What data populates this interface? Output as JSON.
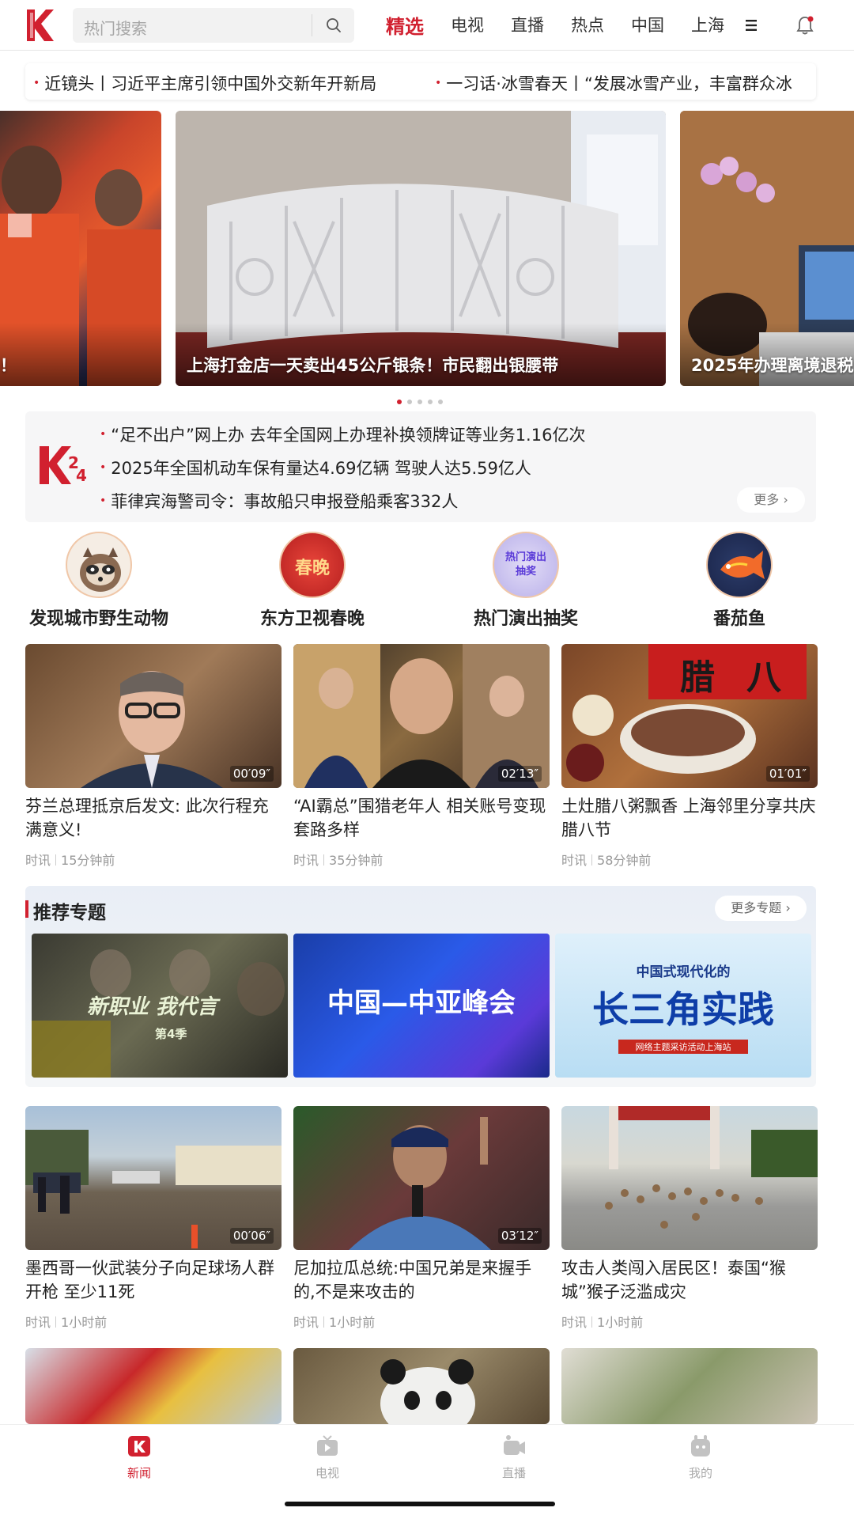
{
  "header": {
    "search_placeholder": "热门搜索",
    "tabs": [
      {
        "label": "精选",
        "active": true
      },
      {
        "label": "电视"
      },
      {
        "label": "直播"
      },
      {
        "label": "热点"
      },
      {
        "label": "中国"
      },
      {
        "label": "上海"
      }
    ]
  },
  "ticker": [
    "近镜头丨习近平主席引领中国外交新年开新局",
    "一习话·冰雪春天丨“发展冰雪产业，丰富群众冰"
  ],
  "carousel": {
    "slides": [
      {
        "caption": "！"
      },
      {
        "caption": "上海打金店一天卖出45公斤银条！市民翻出银腰带"
      },
      {
        "caption": "2025年办理离境退税"
      }
    ],
    "dot_count": 5,
    "active_index": 0
  },
  "newsbox": {
    "items": [
      "“足不出户”网上办 去年全国网上办理补换领牌证等业务1.16亿次",
      "2025年全国机动车保有量达4.69亿辆 驾驶人达5.59亿人",
      "菲律宾海警司令：事故船只申报登船乘客332人"
    ],
    "more_label": "更多 ›"
  },
  "topics": [
    {
      "label": "发现城市野生动物"
    },
    {
      "label": "东方卫视春晚",
      "badge": "春晚"
    },
    {
      "label": "热门演出抽奖",
      "badge": "热门演出抽奖"
    },
    {
      "label": "番茄鱼"
    }
  ],
  "videos_row1": [
    {
      "title": "芬兰总理抵京后发文: 此次行程充满意义!",
      "duration": "00′09″",
      "source": "时讯",
      "time": "15分钟前"
    },
    {
      "title": "“AI霸总”围猎老年人 相关账号变现套路多样",
      "duration": "02′13″",
      "source": "时讯",
      "time": "35分钟前"
    },
    {
      "title": "土灶腊八粥飘香 上海邻里分享共庆腊八节",
      "duration": "01′01″",
      "source": "时讯",
      "time": "58分钟前",
      "badge": "腊八"
    }
  ],
  "recommend": {
    "title": "推荐专题",
    "more_label": "更多专题 ›",
    "banners": [
      {
        "text": "新职业 我代言",
        "sub": "第4季"
      },
      {
        "text": "中国—中亚峰会"
      },
      {
        "text": "长三角实践",
        "top": "中国式现代化的",
        "sub": "网络主题采访活动上海站"
      }
    ]
  },
  "videos_row2": [
    {
      "title": "墨西哥一伙武装分子向足球场人群开枪 至少11死",
      "duration": "00′06″",
      "source": "时讯",
      "time": "1小时前"
    },
    {
      "title": "尼加拉瓜总统:中国兄弟是来握手的,不是来攻击的",
      "duration": "03′12″",
      "source": "时讯",
      "time": "1小时前"
    },
    {
      "title": "攻击人类闯入居民区！泰国“猴城”猴子泛滥成灾",
      "duration": "",
      "source": "时讯",
      "time": "1小时前"
    }
  ],
  "bottom_nav": [
    {
      "label": "新闻",
      "active": true
    },
    {
      "label": "电视"
    },
    {
      "label": "直播"
    },
    {
      "label": "我的"
    }
  ],
  "colors": {
    "accent": "#d1202f"
  }
}
